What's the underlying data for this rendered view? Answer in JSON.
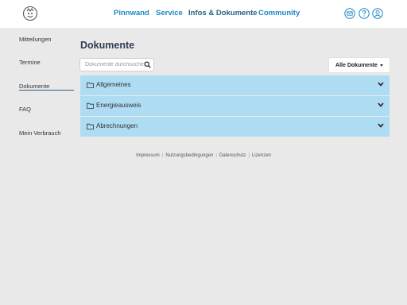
{
  "nav": {
    "items": [
      {
        "label": "Pinnwand"
      },
      {
        "label": "Service"
      },
      {
        "label": "Infos & Dokumente",
        "active": true
      },
      {
        "label": "Community"
      }
    ]
  },
  "header_icons": [
    "mail-icon",
    "help-icon",
    "user-icon"
  ],
  "sidebar": {
    "items": [
      {
        "label": "Mitteilungen"
      },
      {
        "label": "Termine"
      },
      {
        "label": "Dokumente",
        "active": true
      },
      {
        "label": "FAQ"
      },
      {
        "label": "Mein Verbrauch"
      }
    ]
  },
  "main": {
    "title": "Dokumente",
    "search_placeholder": "Dokumente durchsuchen",
    "filter_label": "Alle Dokumente",
    "folders": [
      {
        "label": "Allgemeines"
      },
      {
        "label": "Energieausweis"
      },
      {
        "label": "Abrechnungen"
      }
    ]
  },
  "footer": {
    "links": [
      "Impressum",
      "Nutzungsbedingungen",
      "Datenschutz",
      "Lizenzen"
    ]
  },
  "colors": {
    "accent": "#1a87c7",
    "nav_active": "#2b5f86",
    "folder_row": "#aedcf3",
    "background": "#e9e9e9"
  }
}
